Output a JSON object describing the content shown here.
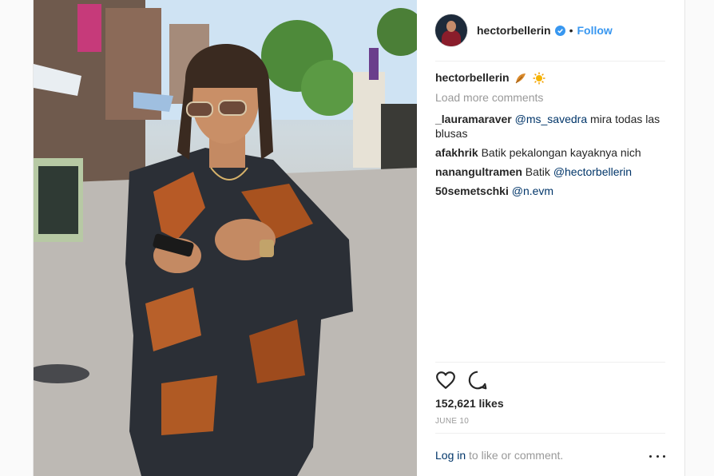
{
  "post": {
    "username": "hectorbellerin",
    "separator": "•",
    "follow_label": "Follow",
    "caption": {
      "username": "hectorbellerin",
      "emoji": [
        "leaves-emoji",
        "sun-emoji"
      ]
    },
    "load_more_label": "Load more comments",
    "comments": [
      {
        "user": "_lauramaraver",
        "mention": "@ms_savedra",
        "text": " mira todas las blusas"
      },
      {
        "user": "afakhrik",
        "text": "Batik pekalongan kayaknya nich"
      },
      {
        "user": "nanangultramen",
        "text": "Batik ",
        "mention": "@hectorbellerin"
      },
      {
        "user": "50semetschki",
        "mention": "@n.evm"
      }
    ],
    "likes": "152,621 likes",
    "date": "JUNE 10",
    "login_link": "Log in",
    "login_rest": " to like or comment."
  },
  "icons": {
    "verified": "verified-badge-icon",
    "like": "heart-icon",
    "comment": "comment-bubble-icon",
    "more": "more-options-icon"
  },
  "colors": {
    "link_blue": "#3897f0",
    "mention_navy": "#003569",
    "muted": "#999999",
    "text": "#262626"
  }
}
